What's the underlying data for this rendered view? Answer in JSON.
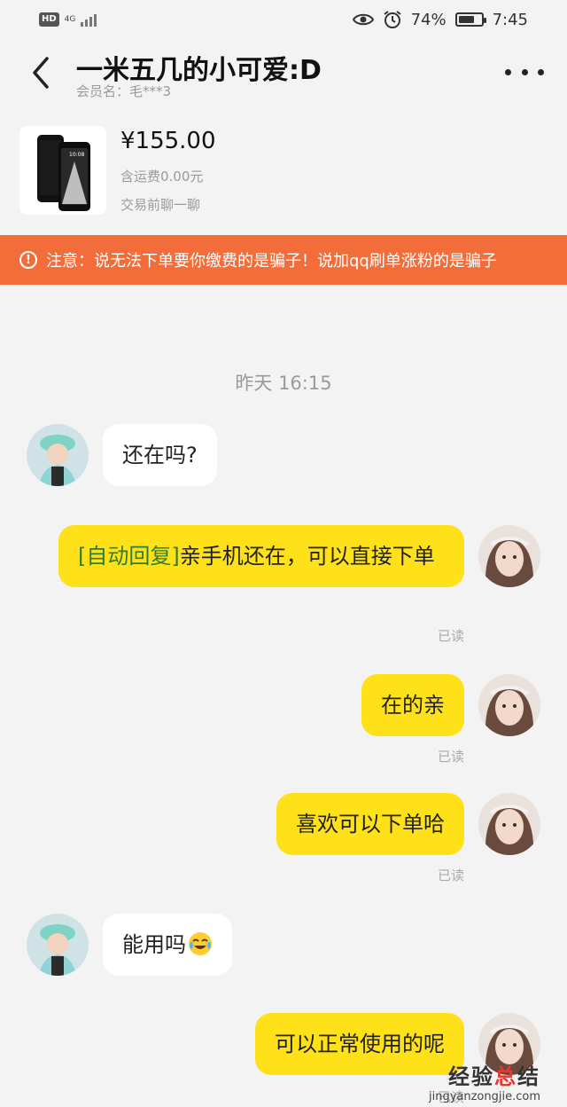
{
  "status_bar": {
    "hd": "HD",
    "network": "4G",
    "battery_percent": "74%",
    "battery_level": 0.74,
    "time": "7:45"
  },
  "header": {
    "title": "一米五几的小可爱:D",
    "subtitle": "会员名：毛***3"
  },
  "product": {
    "price": "¥155.00",
    "shipping": "含运费0.00元",
    "chat_hint": "交易前聊一聊"
  },
  "notice": {
    "text": "注意：说无法下单要你缴费的是骗子！说加qq刷单涨粉的是骗子"
  },
  "chat": {
    "timestamp": "昨天 16:15",
    "messages": [
      {
        "side": "left",
        "text": "还在吗?"
      },
      {
        "side": "right",
        "tag": "[自动回复]",
        "text": "亲手机还在，可以直接下单",
        "status": "已读"
      },
      {
        "side": "right",
        "text": "在的亲",
        "status": "已读"
      },
      {
        "side": "right",
        "text": "喜欢可以下单哈",
        "status": "已读"
      },
      {
        "side": "left",
        "text": "能用吗"
      },
      {
        "side": "right",
        "text": "可以正常使用的呢",
        "status": "已读"
      }
    ]
  },
  "watermark": {
    "main_a": "经验",
    "main_b": "总",
    "main_c": "结",
    "url": "jingyanzongjie.com"
  },
  "colors": {
    "notice_bg": "#f26d3a",
    "seller_bubble": "#ffe11a",
    "buyer_bubble": "#ffffff",
    "auto_tag": "#2e7d32"
  }
}
